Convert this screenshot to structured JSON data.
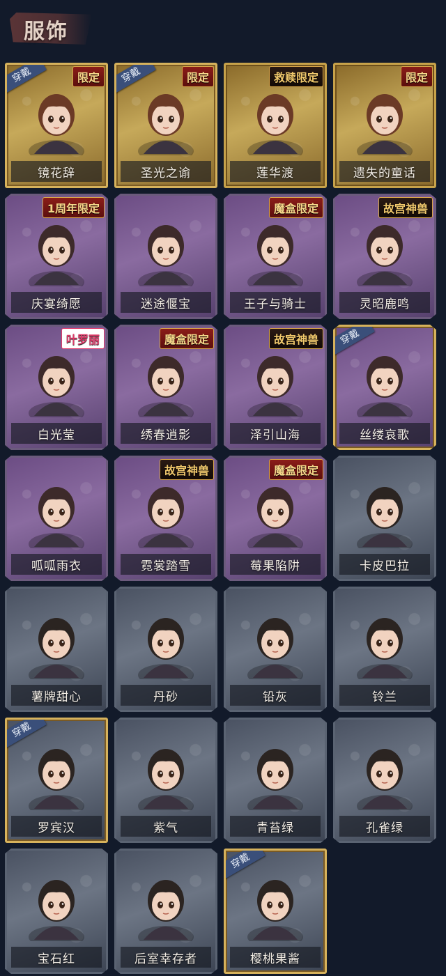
{
  "header": {
    "title": "服饰"
  },
  "labels": {
    "wearing": "穿戴"
  },
  "icons": {
    "portrait": "character-portrait"
  },
  "colors": {
    "background": "#121a2a",
    "gold_frame": "#c7a24a",
    "purple_frame": "#6b5a7c",
    "gray_frame": "#5a6372",
    "wearing_ribbon": "#3a4f7a"
  },
  "costumes": [
    {
      "name": "镜花辞",
      "rarity": "gold",
      "badge": "限定",
      "worn": true
    },
    {
      "name": "圣光之谕",
      "rarity": "gold",
      "badge": "限定",
      "worn": true
    },
    {
      "name": "莲华渡",
      "rarity": "gold",
      "badge": "救赎限定",
      "worn": false
    },
    {
      "name": "遗失的童话",
      "rarity": "gold",
      "badge": "限定",
      "worn": false
    },
    {
      "name": "庆宴绮愿",
      "rarity": "purple",
      "badge": "1周年限定",
      "worn": false
    },
    {
      "name": "迷途偃宝",
      "rarity": "purple",
      "badge": "",
      "worn": false
    },
    {
      "name": "王子与骑士",
      "rarity": "purple",
      "badge": "魔盒限定",
      "worn": false
    },
    {
      "name": "灵昭鹿鸣",
      "rarity": "purple",
      "badge": "故宫神兽",
      "worn": false
    },
    {
      "name": "白光莹",
      "rarity": "purple",
      "badge": "叶罗丽",
      "worn": false
    },
    {
      "name": "绣春逍影",
      "rarity": "purple",
      "badge": "魔盒限定",
      "worn": false
    },
    {
      "name": "泽引山海",
      "rarity": "purple",
      "badge": "故宫神兽",
      "worn": false
    },
    {
      "name": "丝缕哀歌",
      "rarity": "purple",
      "badge": "",
      "worn": true
    },
    {
      "name": "呱呱雨衣",
      "rarity": "purple",
      "badge": "",
      "worn": false
    },
    {
      "name": "霓裳踏雪",
      "rarity": "purple",
      "badge": "故宫神兽",
      "worn": false
    },
    {
      "name": "莓果陷阱",
      "rarity": "purple",
      "badge": "魔盒限定",
      "worn": false
    },
    {
      "name": "卡皮巴拉",
      "rarity": "gray",
      "badge": "",
      "worn": false
    },
    {
      "name": "薯牌甜心",
      "rarity": "gray",
      "badge": "",
      "worn": false
    },
    {
      "name": "丹砂",
      "rarity": "gray",
      "badge": "",
      "worn": false
    },
    {
      "name": "铅灰",
      "rarity": "gray",
      "badge": "",
      "worn": false
    },
    {
      "name": "铃兰",
      "rarity": "gray",
      "badge": "",
      "worn": false
    },
    {
      "name": "罗宾汉",
      "rarity": "gray",
      "badge": "",
      "worn": true
    },
    {
      "name": "紫气",
      "rarity": "gray",
      "badge": "",
      "worn": false
    },
    {
      "name": "青苔绿",
      "rarity": "gray",
      "badge": "",
      "worn": false
    },
    {
      "name": "孔雀绿",
      "rarity": "gray",
      "badge": "",
      "worn": false
    },
    {
      "name": "宝石红",
      "rarity": "gray",
      "badge": "",
      "worn": false
    },
    {
      "name": "后室幸存者",
      "rarity": "gray",
      "badge": "",
      "worn": false
    },
    {
      "name": "樱桃果酱",
      "rarity": "gray",
      "badge": "",
      "worn": true
    }
  ]
}
